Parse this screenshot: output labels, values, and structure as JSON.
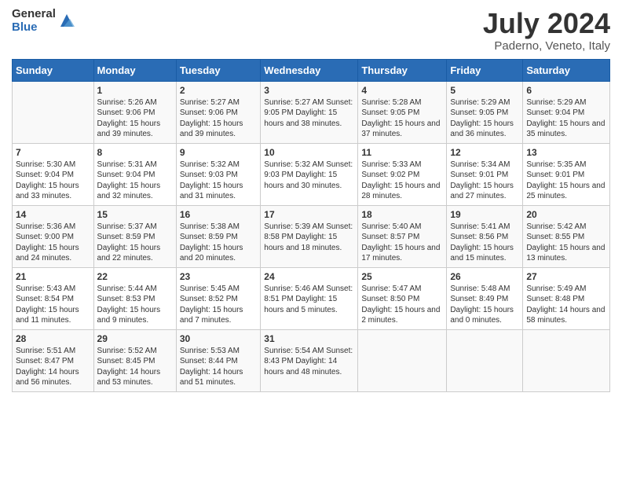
{
  "header": {
    "logo_general": "General",
    "logo_blue": "Blue",
    "title": "July 2024",
    "subtitle": "Paderno, Veneto, Italy"
  },
  "calendar": {
    "days_of_week": [
      "Sunday",
      "Monday",
      "Tuesday",
      "Wednesday",
      "Thursday",
      "Friday",
      "Saturday"
    ],
    "weeks": [
      [
        {
          "num": "",
          "info": ""
        },
        {
          "num": "1",
          "info": "Sunrise: 5:26 AM\nSunset: 9:06 PM\nDaylight: 15 hours\nand 39 minutes."
        },
        {
          "num": "2",
          "info": "Sunrise: 5:27 AM\nSunset: 9:06 PM\nDaylight: 15 hours\nand 39 minutes."
        },
        {
          "num": "3",
          "info": "Sunrise: 5:27 AM\nSunset: 9:05 PM\nDaylight: 15 hours\nand 38 minutes."
        },
        {
          "num": "4",
          "info": "Sunrise: 5:28 AM\nSunset: 9:05 PM\nDaylight: 15 hours\nand 37 minutes."
        },
        {
          "num": "5",
          "info": "Sunrise: 5:29 AM\nSunset: 9:05 PM\nDaylight: 15 hours\nand 36 minutes."
        },
        {
          "num": "6",
          "info": "Sunrise: 5:29 AM\nSunset: 9:04 PM\nDaylight: 15 hours\nand 35 minutes."
        }
      ],
      [
        {
          "num": "7",
          "info": "Sunrise: 5:30 AM\nSunset: 9:04 PM\nDaylight: 15 hours\nand 33 minutes."
        },
        {
          "num": "8",
          "info": "Sunrise: 5:31 AM\nSunset: 9:04 PM\nDaylight: 15 hours\nand 32 minutes."
        },
        {
          "num": "9",
          "info": "Sunrise: 5:32 AM\nSunset: 9:03 PM\nDaylight: 15 hours\nand 31 minutes."
        },
        {
          "num": "10",
          "info": "Sunrise: 5:32 AM\nSunset: 9:03 PM\nDaylight: 15 hours\nand 30 minutes."
        },
        {
          "num": "11",
          "info": "Sunrise: 5:33 AM\nSunset: 9:02 PM\nDaylight: 15 hours\nand 28 minutes."
        },
        {
          "num": "12",
          "info": "Sunrise: 5:34 AM\nSunset: 9:01 PM\nDaylight: 15 hours\nand 27 minutes."
        },
        {
          "num": "13",
          "info": "Sunrise: 5:35 AM\nSunset: 9:01 PM\nDaylight: 15 hours\nand 25 minutes."
        }
      ],
      [
        {
          "num": "14",
          "info": "Sunrise: 5:36 AM\nSunset: 9:00 PM\nDaylight: 15 hours\nand 24 minutes."
        },
        {
          "num": "15",
          "info": "Sunrise: 5:37 AM\nSunset: 8:59 PM\nDaylight: 15 hours\nand 22 minutes."
        },
        {
          "num": "16",
          "info": "Sunrise: 5:38 AM\nSunset: 8:59 PM\nDaylight: 15 hours\nand 20 minutes."
        },
        {
          "num": "17",
          "info": "Sunrise: 5:39 AM\nSunset: 8:58 PM\nDaylight: 15 hours\nand 18 minutes."
        },
        {
          "num": "18",
          "info": "Sunrise: 5:40 AM\nSunset: 8:57 PM\nDaylight: 15 hours\nand 17 minutes."
        },
        {
          "num": "19",
          "info": "Sunrise: 5:41 AM\nSunset: 8:56 PM\nDaylight: 15 hours\nand 15 minutes."
        },
        {
          "num": "20",
          "info": "Sunrise: 5:42 AM\nSunset: 8:55 PM\nDaylight: 15 hours\nand 13 minutes."
        }
      ],
      [
        {
          "num": "21",
          "info": "Sunrise: 5:43 AM\nSunset: 8:54 PM\nDaylight: 15 hours\nand 11 minutes."
        },
        {
          "num": "22",
          "info": "Sunrise: 5:44 AM\nSunset: 8:53 PM\nDaylight: 15 hours\nand 9 minutes."
        },
        {
          "num": "23",
          "info": "Sunrise: 5:45 AM\nSunset: 8:52 PM\nDaylight: 15 hours\nand 7 minutes."
        },
        {
          "num": "24",
          "info": "Sunrise: 5:46 AM\nSunset: 8:51 PM\nDaylight: 15 hours\nand 5 minutes."
        },
        {
          "num": "25",
          "info": "Sunrise: 5:47 AM\nSunset: 8:50 PM\nDaylight: 15 hours\nand 2 minutes."
        },
        {
          "num": "26",
          "info": "Sunrise: 5:48 AM\nSunset: 8:49 PM\nDaylight: 15 hours\nand 0 minutes."
        },
        {
          "num": "27",
          "info": "Sunrise: 5:49 AM\nSunset: 8:48 PM\nDaylight: 14 hours\nand 58 minutes."
        }
      ],
      [
        {
          "num": "28",
          "info": "Sunrise: 5:51 AM\nSunset: 8:47 PM\nDaylight: 14 hours\nand 56 minutes."
        },
        {
          "num": "29",
          "info": "Sunrise: 5:52 AM\nSunset: 8:45 PM\nDaylight: 14 hours\nand 53 minutes."
        },
        {
          "num": "30",
          "info": "Sunrise: 5:53 AM\nSunset: 8:44 PM\nDaylight: 14 hours\nand 51 minutes."
        },
        {
          "num": "31",
          "info": "Sunrise: 5:54 AM\nSunset: 8:43 PM\nDaylight: 14 hours\nand 48 minutes."
        },
        {
          "num": "",
          "info": ""
        },
        {
          "num": "",
          "info": ""
        },
        {
          "num": "",
          "info": ""
        }
      ]
    ]
  }
}
